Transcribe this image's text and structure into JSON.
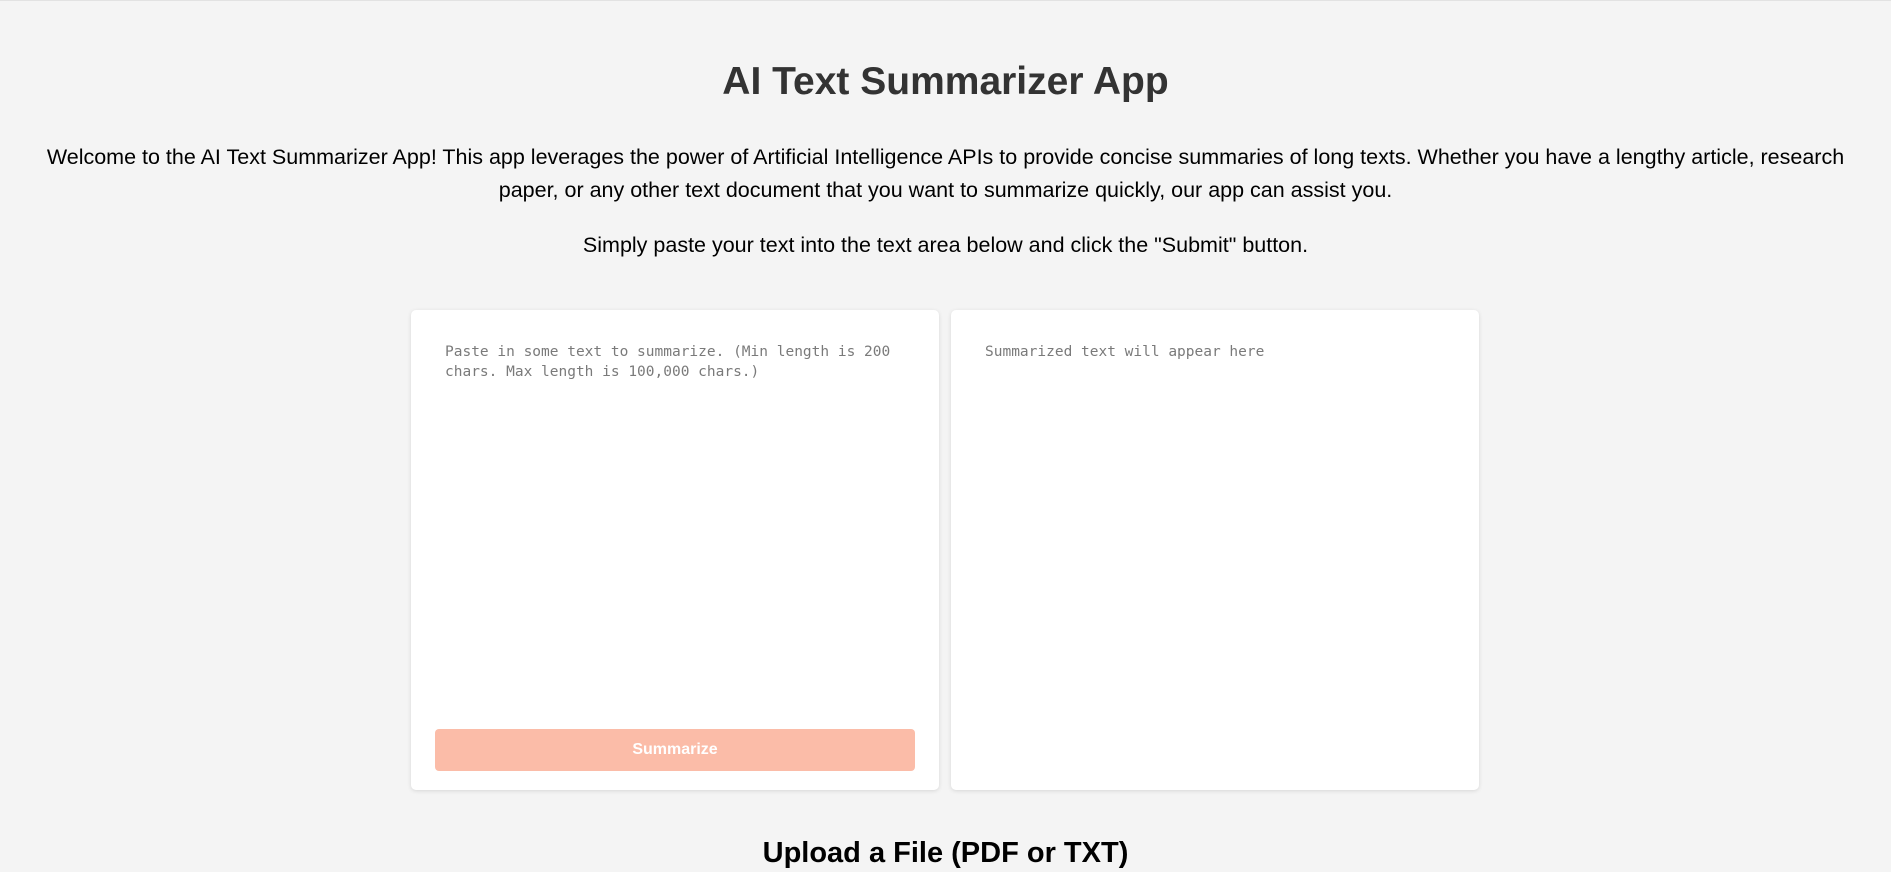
{
  "header": {
    "title": "AI Text Summarizer App"
  },
  "intro": {
    "paragraph": "Welcome to the AI Text Summarizer App! This app leverages the power of Artificial Intelligence APIs to provide concise summaries of long texts. Whether you have a lengthy article, research paper, or any other text document that you want to summarize quickly, our app can assist you.",
    "instructions": "Simply paste your text into the text area below and click the \"Submit\" button."
  },
  "input_panel": {
    "value": "",
    "placeholder": "Paste in some text to summarize. (Min length is 200 chars. Max length is 100,000 chars.)",
    "button_label": "Summarize"
  },
  "output_panel": {
    "value": "",
    "placeholder": "Summarized text will appear here"
  },
  "upload": {
    "heading": "Upload a File (PDF or TXT)"
  },
  "colors": {
    "background": "#f4f4f4",
    "title": "#333333",
    "button_disabled": "#fbbca8",
    "panel": "#ffffff"
  }
}
